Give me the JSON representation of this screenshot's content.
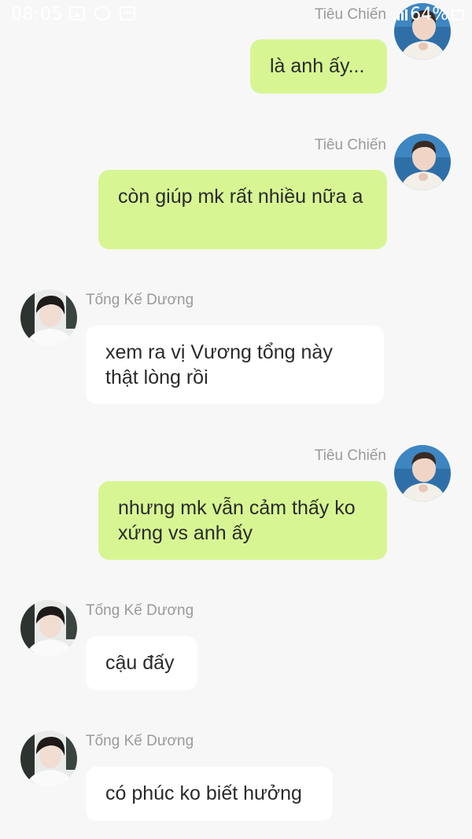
{
  "status_bar": {
    "time": "08:05",
    "battery": "64%"
  },
  "messages": [
    {
      "sender": "Tiêu Chiến",
      "side": "right",
      "text": "là anh ấy..."
    },
    {
      "sender": "Tiêu Chiến",
      "side": "right",
      "text": "còn giúp mk rất nhiều nữa a"
    },
    {
      "sender": "Tống Kế Dương",
      "side": "left",
      "text": "xem ra vị Vương tổng này thật lòng rồi"
    },
    {
      "sender": "Tiêu Chiến",
      "side": "right",
      "text": "nhưng mk vẫn cảm thấy ko xứng vs anh ấy"
    },
    {
      "sender": "Tống Kế Dương",
      "side": "left",
      "text": "cậu đấy"
    },
    {
      "sender": "Tống Kế Dương",
      "side": "left",
      "text": "có phúc ko biết hưởng"
    }
  ],
  "colors": {
    "my_bubble": "#d7f693",
    "other_bubble": "#ffffff",
    "background": "#f7f7f7",
    "name_text": "#9a9a9a"
  }
}
